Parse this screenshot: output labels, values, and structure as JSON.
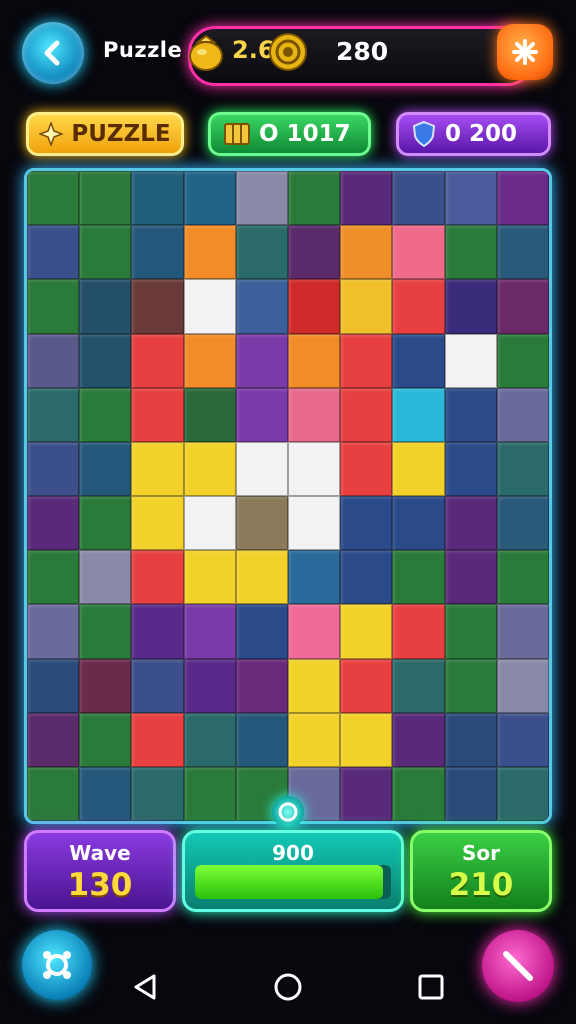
{
  "header": {
    "title": "Puzzle",
    "coins": "2.6",
    "score": "280",
    "back_icon": "chevron-left-icon",
    "settings_icon": "asterisk-icon"
  },
  "stats": {
    "puzzle_label": "PUZZLE",
    "green_value": "O 1017",
    "purple_value": "0 200"
  },
  "board": {
    "columns": 10,
    "rows": 12,
    "colors": [
      "#2a7a3a",
      "#2b7a3a",
      "#1f5f7a",
      "#21648a",
      "#888aa8",
      "#2a7a3a",
      "#5a2a7a",
      "#3b4f8a",
      "#4a5a9a",
      "#6a2a8a",
      "#3b4f8a",
      "#2a7a3a",
      "#24587a",
      "#f28c28",
      "#2a6a6a",
      "#5a2a6a",
      "#ef8f2a",
      "#f06a8a",
      "#2a7a3a",
      "#2a5a7a",
      "#2a7a3a",
      "#234f6a",
      "#6a3a3a",
      "#f2f2f2",
      "#3b5f9a",
      "#cf2a2a",
      "#f0c02a",
      "#e84040",
      "#3a2a7a",
      "#6a2a6a",
      "#5a5a8a",
      "#23506a",
      "#e84040",
      "#f28c28",
      "#7a3aa8",
      "#f28c28",
      "#e84040",
      "#2a4a8a",
      "#f2f2f2",
      "#2a7a3a",
      "#2a6a6a",
      "#2a7a3a",
      "#e84040",
      "#2a6a3a",
      "#7a3aa8",
      "#e86a8a",
      "#e84040",
      "#2bb8d8",
      "#2a4a8a",
      "#6a6a9a",
      "#3b4f8a",
      "#24587a",
      "#f2d22a",
      "#f2d22a",
      "#f2f2f2",
      "#f2f2f2",
      "#e84040",
      "#f2d22a",
      "#2a4a8a",
      "#2a6a6a",
      "#5a2a7a",
      "#2a7a3a",
      "#f2d22a",
      "#f2f2f2",
      "#8a7a5a",
      "#f2f2f2",
      "#2a4a8a",
      "#2a4a8a",
      "#5a2a7a",
      "#2a5a7a",
      "#2a7a3a",
      "#8a8aa8",
      "#e84040",
      "#f2d22a",
      "#f2d22a",
      "#2a6a9a",
      "#2a4a8a",
      "#2a7a3a",
      "#5a2a7a",
      "#2a7a3a",
      "#6a6a9a",
      "#2a7a3a",
      "#5a2a8a",
      "#7a3aa8",
      "#2a4a8a",
      "#f06a9a",
      "#f2d22a",
      "#e84040",
      "#2a7a3a",
      "#6a6a9a",
      "#2a4a7a",
      "#6a2a4a",
      "#3b4f8a",
      "#5a2a8a",
      "#6a2a7a",
      "#f2d22a",
      "#e84040",
      "#2a6a6a",
      "#2a7a3a",
      "#8a8aa8",
      "#5a2a6a",
      "#2a7a3a",
      "#e84040",
      "#2a6a6a",
      "#24587a",
      "#f2d22a",
      "#f2d22a",
      "#5a2a7a",
      "#2a4a7a",
      "#3b4f8a",
      "#2a7a3a",
      "#24587a",
      "#2a6a6a",
      "#2a7a3a",
      "#2a7a3a",
      "#6a6a9a",
      "#5a2a7a",
      "#2a7a3a",
      "#2a4a7a",
      "#2a6a6a"
    ]
  },
  "panels": {
    "left_label": "Wave",
    "left_value": "130",
    "mid_label": "900",
    "mid_progress": 0.96,
    "right_label": "Sor",
    "right_value": "210"
  },
  "footer": {
    "left_icon": "crosshair-icon",
    "right_icon": "wand-icon",
    "nav_back_icon": "nav-back-icon",
    "nav_home_icon": "nav-home-icon",
    "nav_recent_icon": "nav-recent-icon"
  }
}
